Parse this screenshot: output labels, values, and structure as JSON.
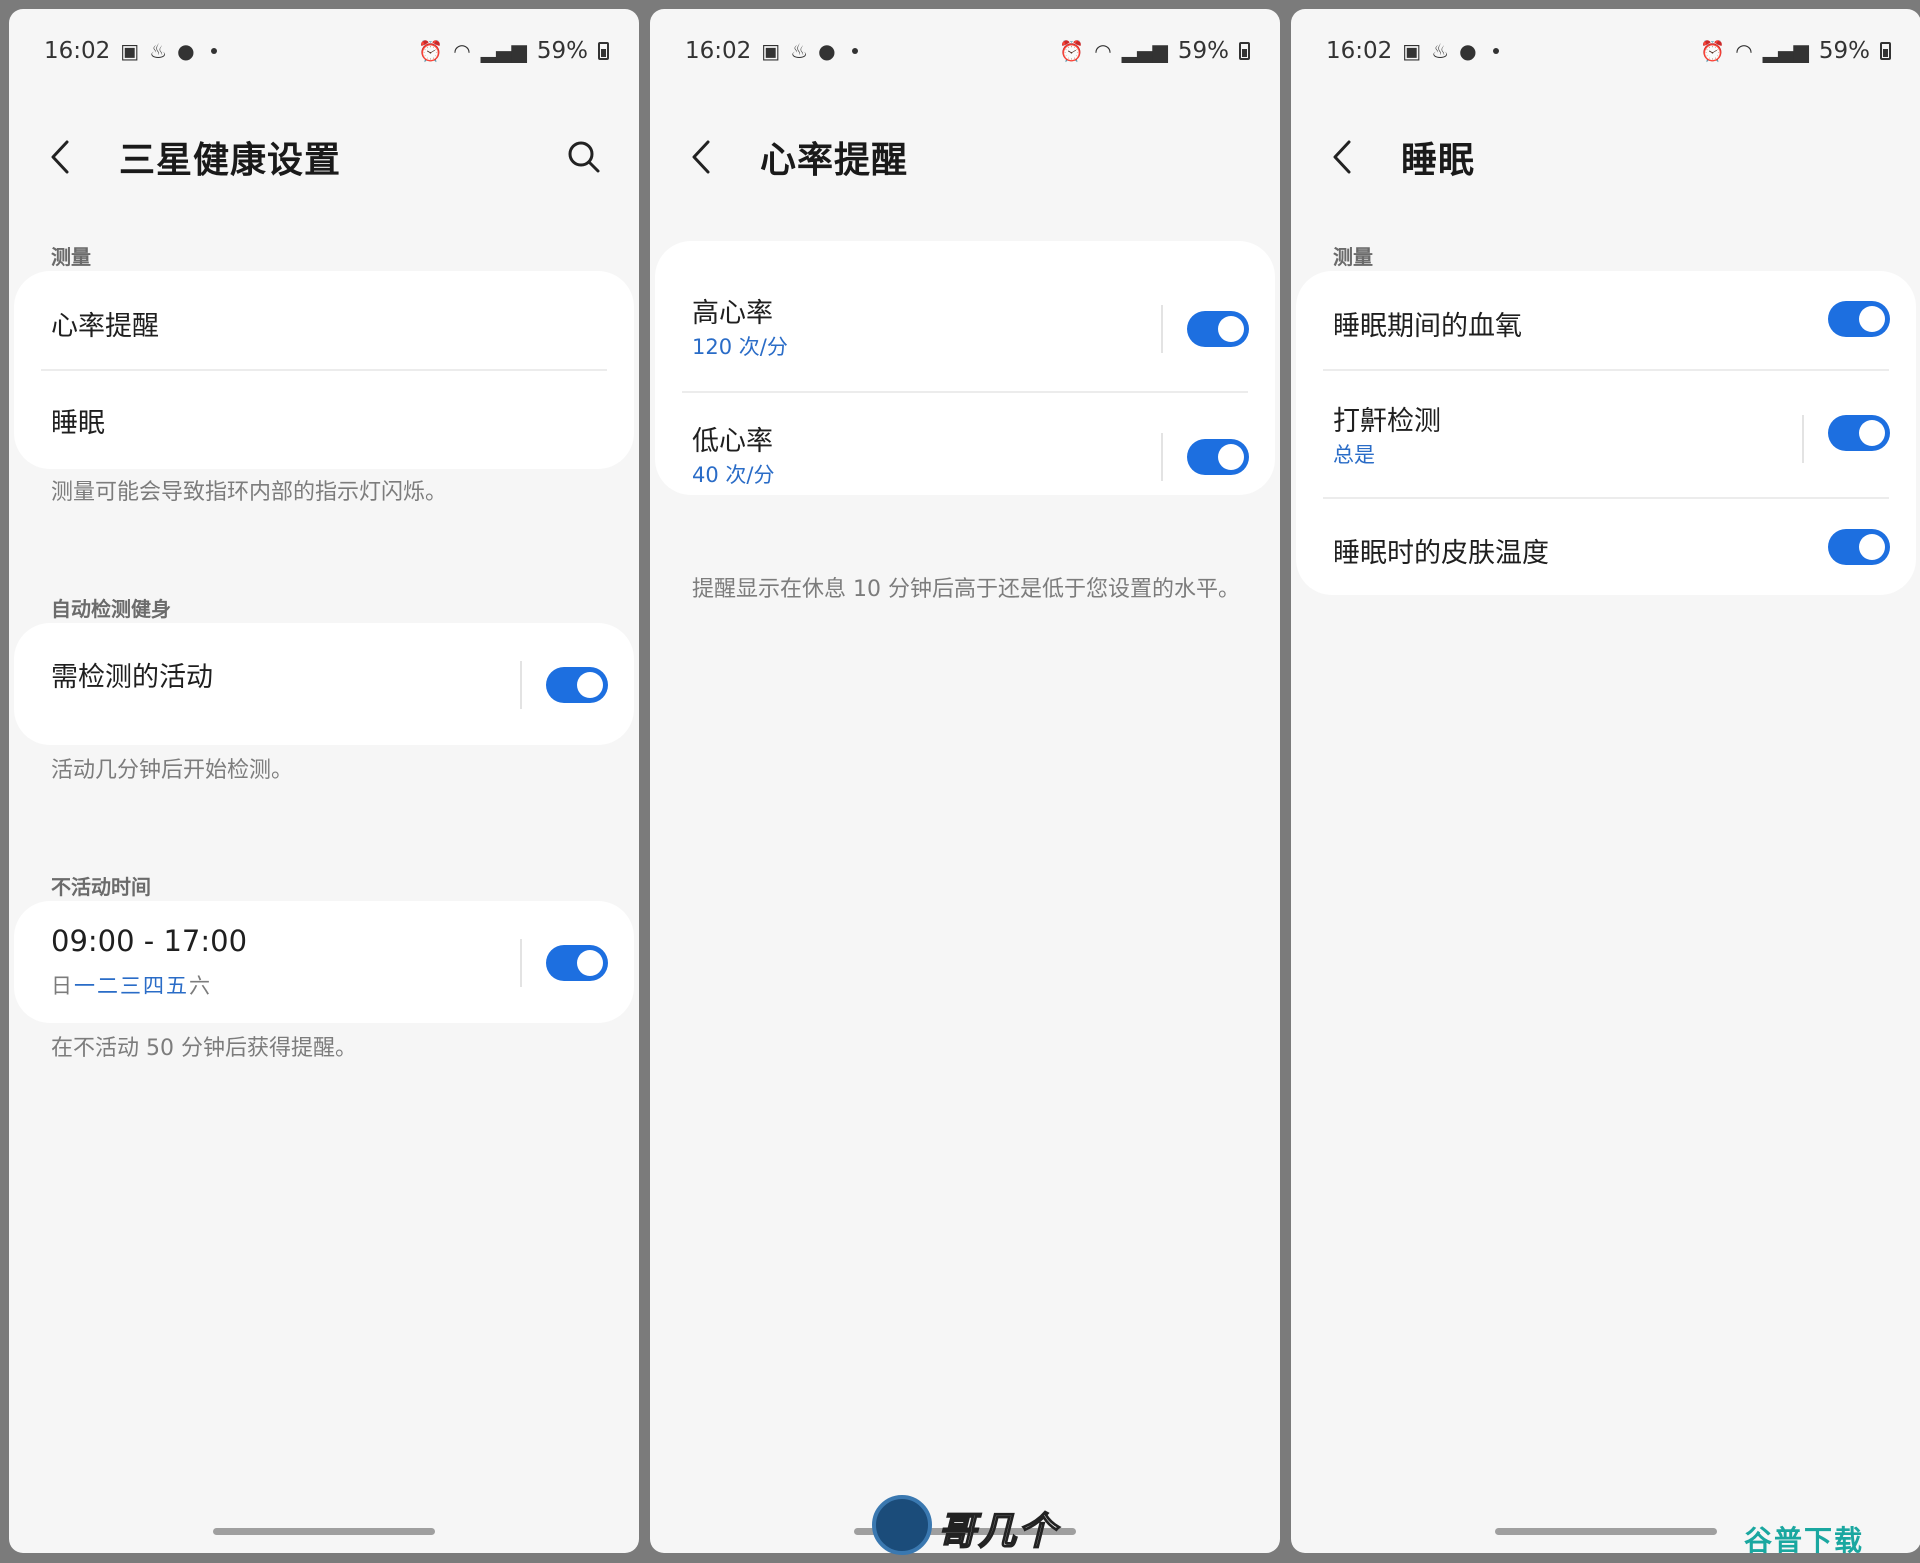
{
  "status_bar": {
    "time": "16:02",
    "battery": "59%"
  },
  "colors": {
    "accent": "#1d6fe0",
    "link_text": "#2a6cc7",
    "background": "#f6f6f6",
    "card": "#ffffff"
  },
  "screen1": {
    "title": "三星健康设置",
    "sections": {
      "measure_label": "测量",
      "measure_items": [
        "心率提醒",
        "睡眠"
      ],
      "measure_hint": "测量可能会导致指环内部的指示灯闪烁。",
      "auto_label": "自动检测健身",
      "auto_item": "需检测的活动",
      "auto_hint": "活动几分钟后开始检测。",
      "inactive_label": "不活动时间",
      "inactive_time": "09:00 - 17:00",
      "inactive_days": [
        "日",
        "一",
        "二",
        "三",
        "四",
        "五",
        "六"
      ],
      "inactive_hint": "在不活动 50 分钟后获得提醒。"
    }
  },
  "screen2": {
    "title": "心率提醒",
    "items": [
      {
        "label": "高心率",
        "value": "120 次/分"
      },
      {
        "label": "低心率",
        "value": "40 次/分"
      }
    ],
    "hint": "提醒显示在休息 10 分钟后高于还是低于您设置的水平。"
  },
  "screen3": {
    "title": "睡眠",
    "measure_label": "测量",
    "items": [
      {
        "label": "睡眠期间的血氧"
      },
      {
        "label": "打鼾检测",
        "value": "总是"
      },
      {
        "label": "睡眠时的皮肤温度"
      }
    ]
  },
  "watermark": {
    "brand": "哥几个",
    "site": "谷普下载"
  }
}
